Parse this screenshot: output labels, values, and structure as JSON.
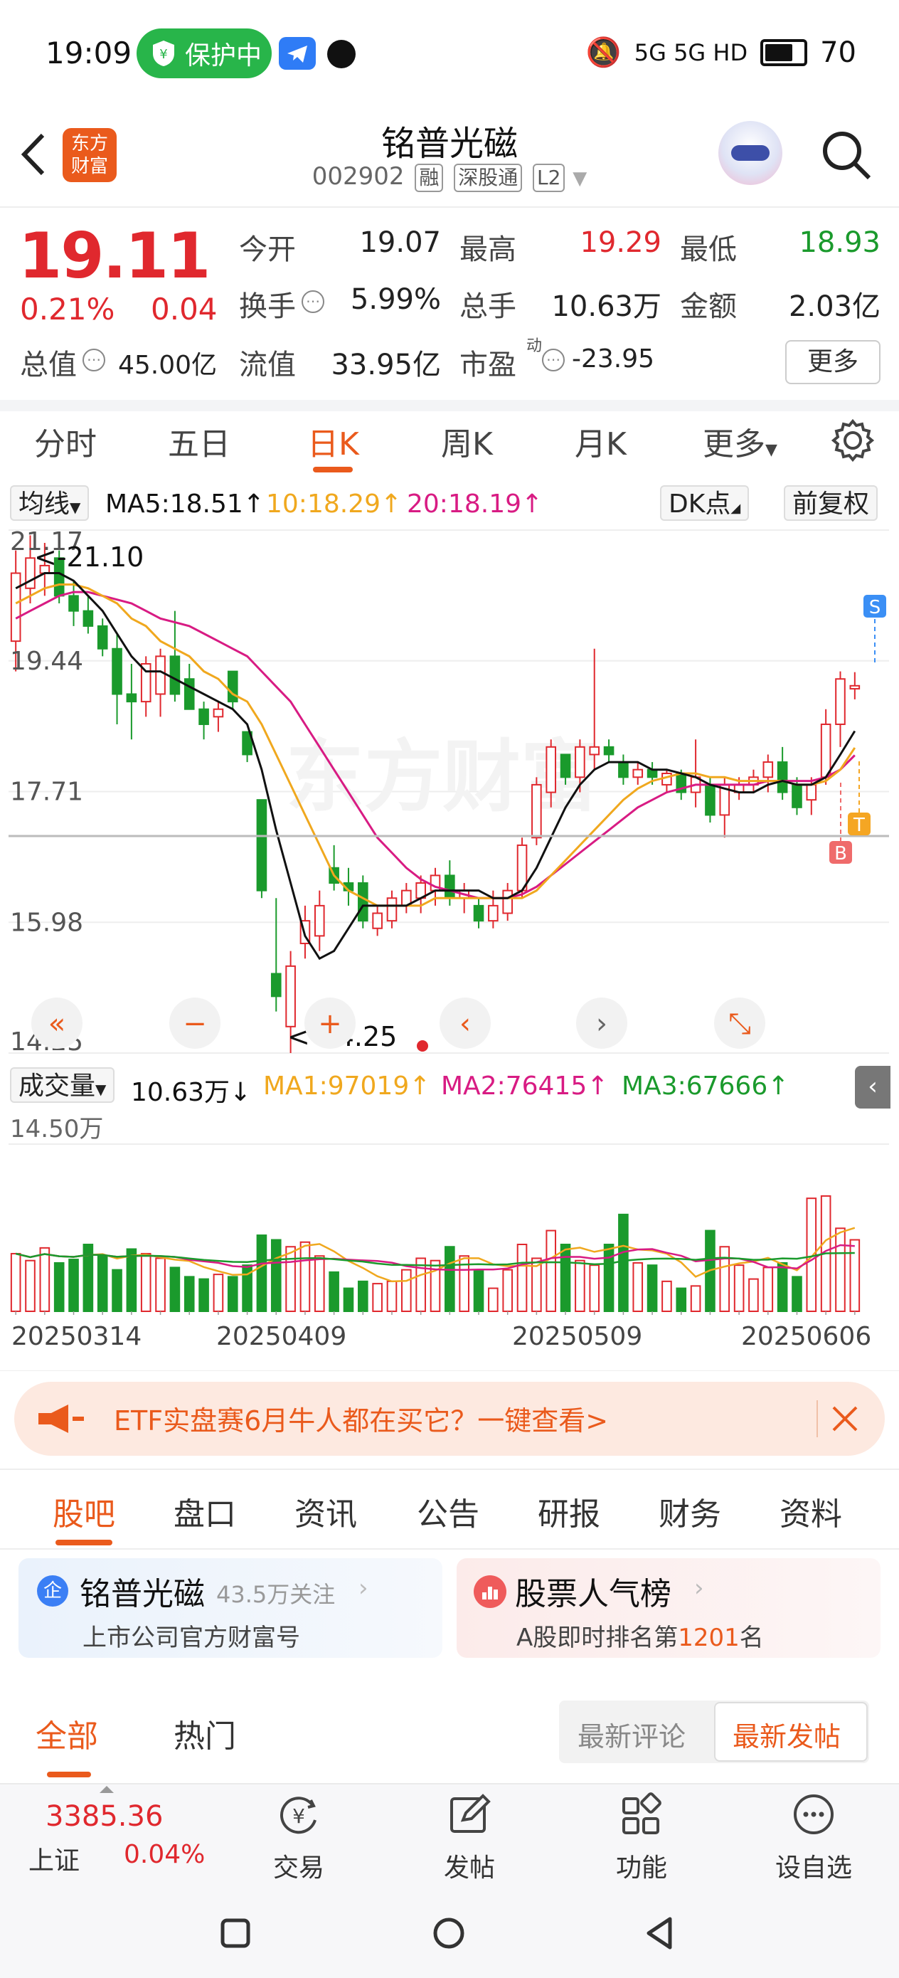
{
  "status_bar": {
    "time": "19:09",
    "protect_label": "保护中",
    "signal": "5G 5G HD",
    "battery": "70"
  },
  "header": {
    "logo_text": "东方财富",
    "title": "铭普光磁",
    "code": "002902",
    "tags": [
      "融",
      "深股通",
      "L2"
    ]
  },
  "quote": {
    "price": "19.11",
    "pct": "0.21%",
    "change": "0.04",
    "open_label": "今开",
    "open": "19.07",
    "high_label": "最高",
    "high": "19.29",
    "low_label": "最低",
    "low": "18.93",
    "turnover_label": "换手",
    "turnover": "5.99%",
    "volume_label": "总手",
    "volume": "10.63万",
    "amount_label": "金额",
    "amount": "2.03亿",
    "mcap_label": "总值",
    "mcap": "45.00亿",
    "float_label": "流值",
    "float": "33.95亿",
    "pe_label": "市盈",
    "pe_sup": "动",
    "pe": "-23.95",
    "more_label": "更多"
  },
  "period_tabs": [
    "分时",
    "五日",
    "日K",
    "周K",
    "月K",
    "更多"
  ],
  "active_period": "日K",
  "ma_row": {
    "ma_label": "均线",
    "ma5": "MA5:18.51↑",
    "ma10": "10:18.29↑",
    "ma20": "20:18.19↑",
    "dk_label": "DK点",
    "adjust_label": "前复权"
  },
  "chart_labels": {
    "high_marker": "<-21.10",
    "low_marker": "<-14.25",
    "s_marker": "S",
    "t_marker": "T",
    "b_marker": "B",
    "watermark": "东方财富"
  },
  "vol_row": {
    "label": "成交量",
    "value": "10.63万↓",
    "ma1": "MA1:97019↑",
    "ma2": "MA2:76415↑",
    "ma3": "MA3:67666↑"
  },
  "colors": {
    "up": "#e0282e",
    "down": "#1a9a2c",
    "ma5": "#111111",
    "ma10": "#f0a81e",
    "ma20": "#d81b83",
    "accent": "#ea5a1c"
  },
  "chart_data": {
    "type": "candlestick",
    "y_ticks": [
      "21.17",
      "19.44",
      "17.71",
      "15.98",
      "14.25"
    ],
    "ylim": [
      14.25,
      21.17
    ],
    "x_ticks": [
      "20250314",
      "20250409",
      "20250509",
      "20250606"
    ],
    "candles": [
      {
        "o": 19.7,
        "h": 20.9,
        "l": 19.3,
        "c": 20.6
      },
      {
        "o": 20.4,
        "h": 21.1,
        "l": 20.2,
        "c": 20.8
      },
      {
        "o": 20.6,
        "h": 21.0,
        "l": 20.3,
        "c": 20.7
      },
      {
        "o": 20.8,
        "h": 20.9,
        "l": 20.2,
        "c": 20.3
      },
      {
        "o": 20.3,
        "h": 20.5,
        "l": 19.9,
        "c": 20.1
      },
      {
        "o": 20.1,
        "h": 20.3,
        "l": 19.8,
        "c": 19.9
      },
      {
        "o": 19.9,
        "h": 20.0,
        "l": 19.5,
        "c": 19.6
      },
      {
        "o": 19.6,
        "h": 19.8,
        "l": 18.6,
        "c": 19.0
      },
      {
        "o": 19.0,
        "h": 19.4,
        "l": 18.4,
        "c": 18.9
      },
      {
        "o": 18.9,
        "h": 19.5,
        "l": 18.7,
        "c": 19.4
      },
      {
        "o": 19.0,
        "h": 19.6,
        "l": 18.7,
        "c": 19.5
      },
      {
        "o": 19.5,
        "h": 20.1,
        "l": 18.9,
        "c": 19.0
      },
      {
        "o": 19.2,
        "h": 19.4,
        "l": 18.8,
        "c": 18.8
      },
      {
        "o": 18.8,
        "h": 18.9,
        "l": 18.4,
        "c": 18.6
      },
      {
        "o": 18.7,
        "h": 18.9,
        "l": 18.5,
        "c": 18.8
      },
      {
        "o": 19.3,
        "h": 19.3,
        "l": 18.8,
        "c": 18.9
      },
      {
        "o": 18.5,
        "h": 18.5,
        "l": 18.1,
        "c": 18.2
      },
      {
        "o": 17.6,
        "h": 17.6,
        "l": 16.3,
        "c": 16.4
      },
      {
        "o": 15.3,
        "h": 16.3,
        "l": 14.8,
        "c": 15.0
      },
      {
        "o": 14.6,
        "h": 15.6,
        "l": 14.25,
        "c": 15.4
      },
      {
        "o": 15.7,
        "h": 16.2,
        "l": 15.5,
        "c": 16.0
      },
      {
        "o": 15.8,
        "h": 16.4,
        "l": 15.6,
        "c": 16.2
      },
      {
        "o": 16.7,
        "h": 17.0,
        "l": 16.4,
        "c": 16.5
      },
      {
        "o": 16.5,
        "h": 16.7,
        "l": 16.2,
        "c": 16.4
      },
      {
        "o": 16.5,
        "h": 16.6,
        "l": 15.9,
        "c": 16.0
      },
      {
        "o": 15.9,
        "h": 16.2,
        "l": 15.8,
        "c": 16.1
      },
      {
        "o": 16.0,
        "h": 16.4,
        "l": 15.9,
        "c": 16.3
      },
      {
        "o": 16.2,
        "h": 16.5,
        "l": 16.1,
        "c": 16.4
      },
      {
        "o": 16.3,
        "h": 16.6,
        "l": 16.1,
        "c": 16.5
      },
      {
        "o": 16.4,
        "h": 16.7,
        "l": 16.2,
        "c": 16.6
      },
      {
        "o": 16.6,
        "h": 16.8,
        "l": 16.2,
        "c": 16.3
      },
      {
        "o": 16.3,
        "h": 16.5,
        "l": 16.1,
        "c": 16.4
      },
      {
        "o": 16.2,
        "h": 16.3,
        "l": 15.9,
        "c": 16.0
      },
      {
        "o": 16.0,
        "h": 16.4,
        "l": 15.9,
        "c": 16.2
      },
      {
        "o": 16.1,
        "h": 16.5,
        "l": 16.0,
        "c": 16.4
      },
      {
        "o": 16.4,
        "h": 17.1,
        "l": 16.3,
        "c": 17.0
      },
      {
        "o": 17.1,
        "h": 17.9,
        "l": 17.0,
        "c": 17.8
      },
      {
        "o": 17.7,
        "h": 18.4,
        "l": 17.5,
        "c": 18.3
      },
      {
        "o": 18.2,
        "h": 18.2,
        "l": 17.8,
        "c": 17.9
      },
      {
        "o": 17.9,
        "h": 18.4,
        "l": 17.7,
        "c": 18.3
      },
      {
        "o": 18.2,
        "h": 19.6,
        "l": 18.0,
        "c": 18.3
      },
      {
        "o": 18.3,
        "h": 18.4,
        "l": 18.1,
        "c": 18.2
      },
      {
        "o": 18.1,
        "h": 18.2,
        "l": 17.8,
        "c": 17.9
      },
      {
        "o": 17.9,
        "h": 18.1,
        "l": 17.8,
        "c": 18.0
      },
      {
        "o": 18.0,
        "h": 18.1,
        "l": 17.8,
        "c": 17.9
      },
      {
        "o": 17.8,
        "h": 18.0,
        "l": 17.7,
        "c": 17.95
      },
      {
        "o": 17.95,
        "h": 18.0,
        "l": 17.6,
        "c": 17.7
      },
      {
        "o": 17.7,
        "h": 18.4,
        "l": 17.5,
        "c": 17.9
      },
      {
        "o": 17.8,
        "h": 17.9,
        "l": 17.3,
        "c": 17.4
      },
      {
        "o": 17.4,
        "h": 17.9,
        "l": 17.1,
        "c": 17.8
      },
      {
        "o": 17.7,
        "h": 17.9,
        "l": 17.6,
        "c": 17.8
      },
      {
        "o": 17.8,
        "h": 18.0,
        "l": 17.7,
        "c": 17.9
      },
      {
        "o": 17.9,
        "h": 18.2,
        "l": 17.7,
        "c": 18.1
      },
      {
        "o": 18.1,
        "h": 18.3,
        "l": 17.6,
        "c": 17.7
      },
      {
        "o": 17.8,
        "h": 17.9,
        "l": 17.4,
        "c": 17.5
      },
      {
        "o": 17.6,
        "h": 17.9,
        "l": 17.4,
        "c": 17.8
      },
      {
        "o": 17.9,
        "h": 18.8,
        "l": 17.8,
        "c": 18.6
      },
      {
        "o": 18.6,
        "h": 19.3,
        "l": 18.3,
        "c": 19.2
      },
      {
        "o": 19.07,
        "h": 19.29,
        "l": 18.93,
        "c": 19.11
      }
    ],
    "ma5": [
      20.4,
      20.5,
      20.6,
      20.6,
      20.5,
      20.3,
      20.1,
      19.8,
      19.5,
      19.3,
      19.3,
      19.2,
      19.1,
      19.0,
      18.9,
      18.8,
      18.6,
      18.0,
      17.2,
      16.5,
      15.8,
      15.5,
      15.6,
      15.9,
      16.2,
      16.2,
      16.2,
      16.2,
      16.3,
      16.4,
      16.4,
      16.4,
      16.4,
      16.3,
      16.3,
      16.4,
      16.7,
      17.1,
      17.5,
      17.8,
      18.0,
      18.1,
      18.1,
      18.1,
      18.0,
      18.0,
      17.95,
      17.9,
      17.8,
      17.75,
      17.7,
      17.7,
      17.8,
      17.85,
      17.8,
      17.8,
      17.9,
      18.2,
      18.51
    ],
    "ma10": [
      20.2,
      20.3,
      20.4,
      20.45,
      20.45,
      20.4,
      20.3,
      20.2,
      20.0,
      19.9,
      19.7,
      19.6,
      19.5,
      19.3,
      19.2,
      19.0,
      18.9,
      18.6,
      18.2,
      17.8,
      17.4,
      17.0,
      16.6,
      16.4,
      16.3,
      16.2,
      16.2,
      16.2,
      16.2,
      16.3,
      16.3,
      16.3,
      16.3,
      16.3,
      16.3,
      16.3,
      16.4,
      16.6,
      16.8,
      17.0,
      17.2,
      17.4,
      17.6,
      17.75,
      17.85,
      17.9,
      17.95,
      17.95,
      17.9,
      17.9,
      17.85,
      17.85,
      17.85,
      17.85,
      17.8,
      17.8,
      17.85,
      18.0,
      18.29
    ],
    "ma20": [
      20.0,
      20.1,
      20.2,
      20.3,
      20.35,
      20.35,
      20.3,
      20.25,
      20.2,
      20.1,
      20.0,
      19.95,
      19.9,
      19.8,
      19.7,
      19.6,
      19.5,
      19.3,
      19.1,
      18.9,
      18.6,
      18.3,
      18.0,
      17.7,
      17.4,
      17.1,
      16.9,
      16.7,
      16.55,
      16.45,
      16.4,
      16.35,
      16.3,
      16.3,
      16.3,
      16.35,
      16.45,
      16.6,
      16.75,
      16.9,
      17.05,
      17.2,
      17.35,
      17.5,
      17.6,
      17.7,
      17.75,
      17.8,
      17.8,
      17.8,
      17.8,
      17.8,
      17.85,
      17.85,
      17.85,
      17.85,
      17.9,
      18.0,
      18.19
    ],
    "volume": [
      0.5,
      0.44,
      0.55,
      0.42,
      0.45,
      0.58,
      0.48,
      0.36,
      0.54,
      0.5,
      0.46,
      0.38,
      0.3,
      0.28,
      0.32,
      0.3,
      0.4,
      0.66,
      0.62,
      0.56,
      0.6,
      0.48,
      0.34,
      0.2,
      0.26,
      0.24,
      0.26,
      0.36,
      0.46,
      0.44,
      0.56,
      0.48,
      0.36,
      0.2,
      0.36,
      0.58,
      0.46,
      0.7,
      0.58,
      0.44,
      0.4,
      0.58,
      0.84,
      0.42,
      0.4,
      0.26,
      0.2,
      0.22,
      0.7,
      0.56,
      0.4,
      0.28,
      0.38,
      0.42,
      0.3,
      0.98,
      1.0,
      0.72,
      0.62
    ],
    "vol_ylim": [
      0,
      1.45
    ],
    "vol_top_label": "14.50万"
  },
  "chart_controls": [
    "«",
    "−",
    "+",
    "‹",
    "›",
    "⤡"
  ],
  "banner": {
    "text": "ETF实盘赛6月牛人都在买它？一键查看>"
  },
  "section_tabs": [
    "股吧",
    "盘口",
    "资讯",
    "公告",
    "研报",
    "财务",
    "资料"
  ],
  "cards": {
    "company_name": "铭普光磁",
    "company_follow": "43.5万关注",
    "company_sub": "上市公司官方财富号",
    "rank_title": "股票人气榜",
    "rank_sub_prefix": "A股即时排名第",
    "rank_num": "1201",
    "rank_sub_suffix": "名"
  },
  "filter": {
    "tab_all": "全部",
    "tab_hot": "热门",
    "sort_latest_comment": "最新评论",
    "sort_latest_post": "最新发帖"
  },
  "bottom_nav": {
    "index_value": "3385.36",
    "index_name": "上证",
    "index_pct": "0.04%",
    "items": [
      "交易",
      "发帖",
      "功能",
      "设自选"
    ]
  }
}
